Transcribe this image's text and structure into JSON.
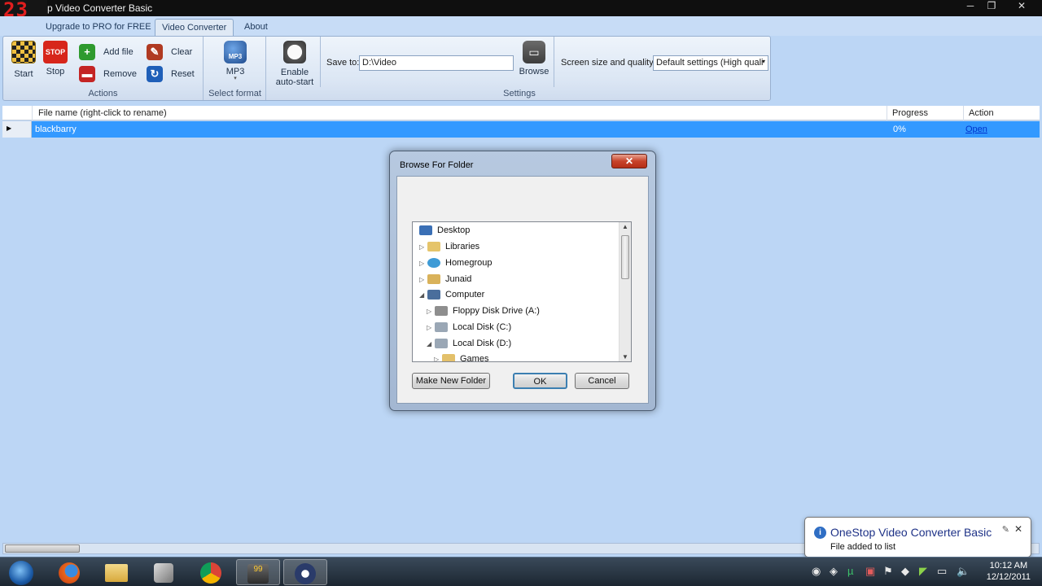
{
  "window": {
    "logo": "23",
    "title": "p Video Converter Basic",
    "controls": {
      "minimize": "─",
      "maximize": "❐",
      "close": "✕"
    }
  },
  "tabs": [
    {
      "label": "Upgrade to PRO for FREE"
    },
    {
      "label": "Video Converter"
    },
    {
      "label": "About"
    }
  ],
  "ribbon": {
    "actions": {
      "group_label": "Actions",
      "start": "Start",
      "stop": "Stop",
      "stop_icon_text": "STOP",
      "add_file": "Add file",
      "remove": "Remove",
      "clear": "Clear",
      "reset": "Reset"
    },
    "format": {
      "group_label": "Select format",
      "label": "MP3",
      "icon_text": "MP3"
    },
    "autostart": {
      "line1": "Enable",
      "line2": "auto-start"
    },
    "settings": {
      "group_label": "Settings",
      "save_to_label": "Save to:",
      "save_to_value": "D:\\Video",
      "browse": "Browse",
      "quality_label": "Screen size and quality",
      "quality_value": "Default settings (High quali"
    }
  },
  "file_list": {
    "columns": {
      "filename": "File name (right-click to rename)",
      "progress": "Progress",
      "action": "Action"
    },
    "rows": [
      {
        "filename": "blackbarry",
        "progress": "0%",
        "action": "Open"
      }
    ]
  },
  "dialog": {
    "title": "Browse For Folder",
    "close": "✕",
    "tree": [
      {
        "label": "Desktop",
        "icon": "desktop-icon"
      },
      {
        "label": "Libraries",
        "icon": "libraries-icon"
      },
      {
        "label": "Homegroup",
        "icon": "homegroup-icon"
      },
      {
        "label": "Junaid",
        "icon": "user-folder-icon"
      },
      {
        "label": "Computer",
        "icon": "computer-icon"
      },
      {
        "label": "Floppy Disk Drive (A:)",
        "icon": "floppy-drive-icon"
      },
      {
        "label": "Local Disk (C:)",
        "icon": "disk-drive-icon"
      },
      {
        "label": "Local Disk (D:)",
        "icon": "disk-drive-icon"
      },
      {
        "label": "Games",
        "icon": "folder-icon"
      }
    ],
    "buttons": {
      "new_folder": "Make New Folder",
      "ok": "OK",
      "cancel": "Cancel"
    }
  },
  "balloon": {
    "title": "OneStop Video Converter Basic",
    "message": "File added to list"
  },
  "taskbar": {
    "apps": [
      "start-orb",
      "firefox",
      "file-explorer",
      "media-app",
      "chrome",
      "99-app",
      "video-converter"
    ],
    "clock_time": "10:12 AM",
    "clock_date": "12/12/2011"
  },
  "colors": {
    "selection": "#3399ff",
    "app_background": "#bcd6f5",
    "close_button": "#c7432a"
  }
}
